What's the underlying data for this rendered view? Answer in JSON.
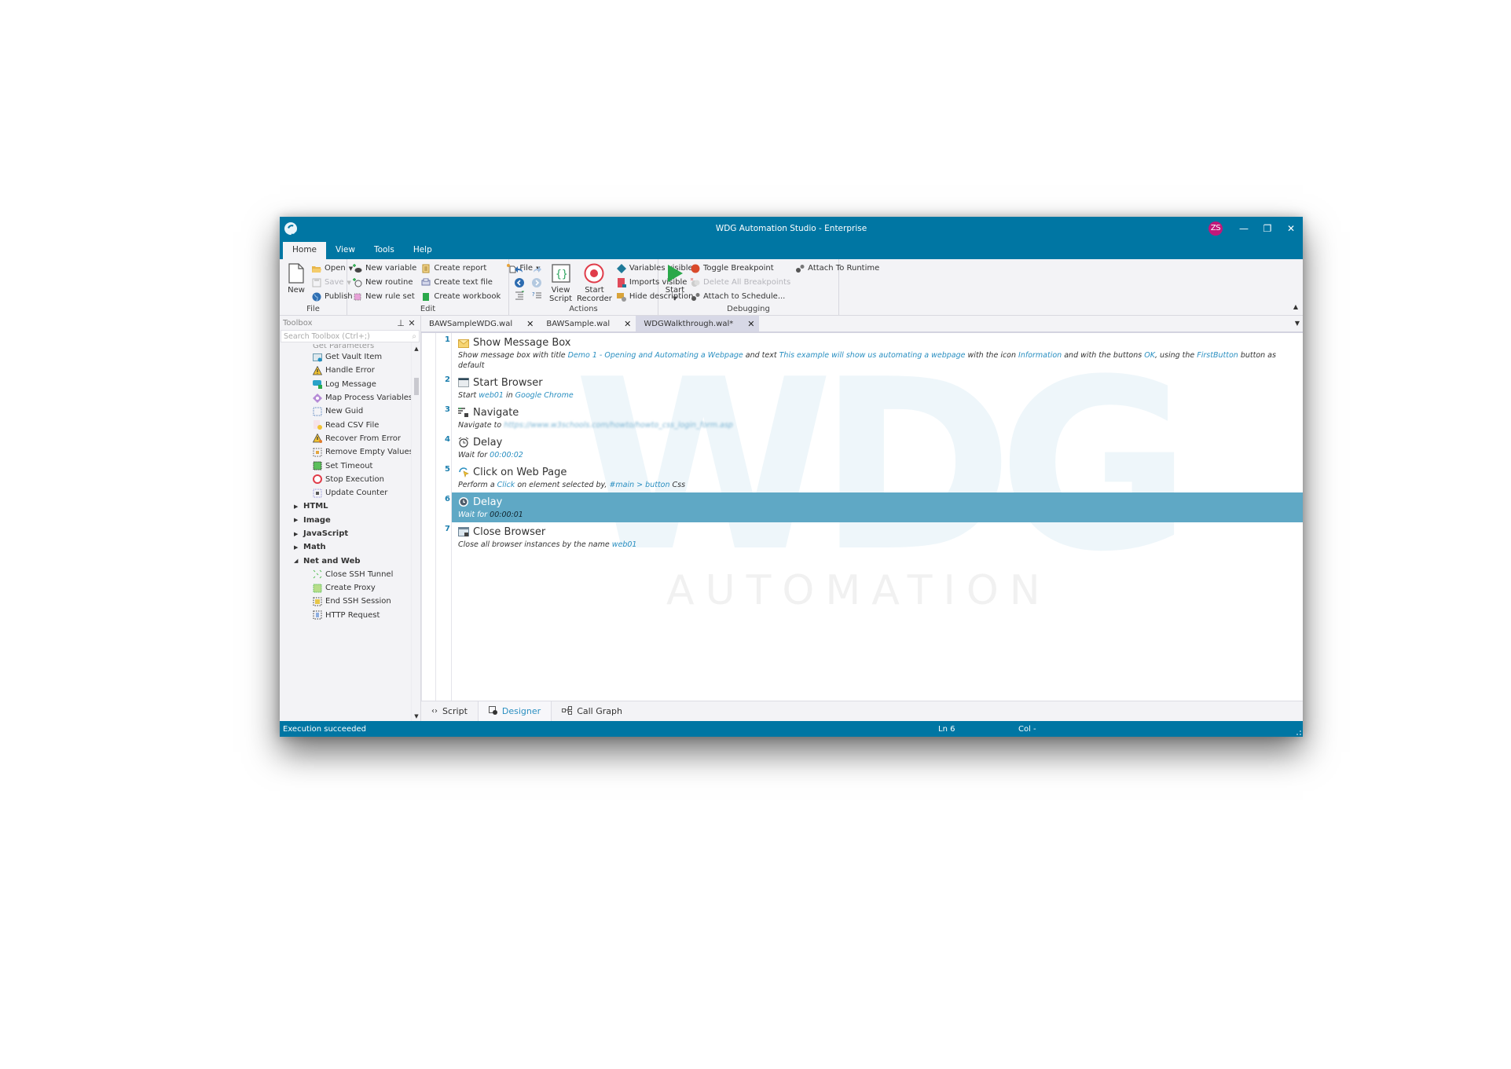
{
  "window": {
    "title": "WDG Automation Studio - Enterprise",
    "user_initials": "ZS",
    "controls": {
      "minimize": "—",
      "restore": "❐",
      "close": "✕"
    }
  },
  "menu": {
    "tabs": [
      {
        "label": "Home",
        "active": true
      },
      {
        "label": "View",
        "active": false
      },
      {
        "label": "Tools",
        "active": false
      },
      {
        "label": "Help",
        "active": false
      }
    ]
  },
  "ribbon": {
    "file_group": {
      "label": "File",
      "new": "New",
      "open": "Open",
      "save": "Save",
      "publish": "Publish"
    },
    "edit_group": {
      "label": "Edit",
      "new_variable": "New variable",
      "new_routine": "New routine",
      "new_rule_set": "New rule set",
      "create_report": "Create report",
      "create_text_file": "Create text file",
      "create_workbook": "Create workbook",
      "file": "File"
    },
    "actions_group": {
      "label": "Actions",
      "view_script_line1": "View",
      "view_script_line2": "Script",
      "start_recorder_line1": "Start",
      "start_recorder_line2": "Recorder",
      "variables_visible": "Variables visible",
      "imports_visible": "Imports visible",
      "hide_description": "Hide description"
    },
    "debugging_group": {
      "label": "Debugging",
      "start": "Start",
      "toggle_breakpoint": "Toggle Breakpoint",
      "delete_all_breakpoints": "Delete All Breakpoints",
      "attach_to_schedule": "Attach to Schedule...",
      "attach_to_runtime": "Attach To Runtime"
    },
    "accent_colors": {
      "record_red": "#e03c4a",
      "start_green": "#2aa84a",
      "braces_green": "#27a25a"
    }
  },
  "toolbox": {
    "title": "Toolbox",
    "search_placeholder": "Search Toolbox (Ctrl+;)",
    "partial_item": "Get Parameters",
    "items": [
      {
        "type": "leaf",
        "label": "Get Vault Item",
        "icon": "vault-icon"
      },
      {
        "type": "leaf",
        "label": "Handle Error",
        "icon": "warning-icon"
      },
      {
        "type": "leaf",
        "label": "Log Message",
        "icon": "log-message-icon"
      },
      {
        "type": "leaf",
        "label": "Map Process Variables",
        "icon": "map-variables-icon"
      },
      {
        "type": "leaf",
        "label": "New Guid",
        "icon": "guid-icon"
      },
      {
        "type": "leaf",
        "label": "Read CSV File",
        "icon": "csv-file-icon"
      },
      {
        "type": "leaf",
        "label": "Recover From Error",
        "icon": "warning-recover-icon"
      },
      {
        "type": "leaf",
        "label": "Remove Empty Values",
        "icon": "remove-empty-icon"
      },
      {
        "type": "leaf",
        "label": "Set Timeout",
        "icon": "timeout-icon"
      },
      {
        "type": "leaf",
        "label": "Stop Execution",
        "icon": "stop-icon"
      },
      {
        "type": "leaf",
        "label": "Update Counter",
        "icon": "counter-icon"
      },
      {
        "type": "cat",
        "label": "HTML",
        "expanded": false
      },
      {
        "type": "cat",
        "label": "Image",
        "expanded": false
      },
      {
        "type": "cat",
        "label": "JavaScript",
        "expanded": false
      },
      {
        "type": "cat",
        "label": "Math",
        "expanded": false
      },
      {
        "type": "cat",
        "label": "Net and Web",
        "expanded": true
      },
      {
        "type": "leaf",
        "label": "Close SSH Tunnel",
        "icon": "ssh-tunnel-icon"
      },
      {
        "type": "leaf",
        "label": "Create Proxy",
        "icon": "proxy-icon"
      },
      {
        "type": "leaf",
        "label": "End SSH Session",
        "icon": "ssh-session-icon"
      },
      {
        "type": "leaf",
        "label": "HTTP Request",
        "icon": "http-request-icon"
      }
    ]
  },
  "editor": {
    "tabs": [
      {
        "label": "BAWSampleWDG.wal",
        "active": false
      },
      {
        "label": "BAWSample.wal",
        "active": false
      },
      {
        "label": "WDGWalkthrough.wal*",
        "active": true
      }
    ],
    "watermark": {
      "big": "WDG",
      "small": "AUTOMATION"
    },
    "steps": [
      {
        "num": "1",
        "title": "Show Message Box",
        "icon": "message-box-icon",
        "desc": [
          {
            "t": "Show message box with title "
          },
          {
            "t": "Demo 1 - Opening and Automating a Webpage",
            "v": true
          },
          {
            "t": " and text "
          },
          {
            "t": "This example will show us automating a webpage",
            "v": true
          },
          {
            "t": " with the icon "
          },
          {
            "t": "Information",
            "v": true
          },
          {
            "t": " and with the buttons "
          },
          {
            "t": "OK",
            "v": true
          },
          {
            "t": ", using the "
          },
          {
            "t": "FirstButton",
            "v": true
          },
          {
            "t": " button as default"
          }
        ]
      },
      {
        "num": "2",
        "title": "Start Browser",
        "icon": "browser-window-icon",
        "desc": [
          {
            "t": "Start "
          },
          {
            "t": "web01",
            "v": true
          },
          {
            "t": " in "
          },
          {
            "t": "Google Chrome",
            "v": true
          }
        ]
      },
      {
        "num": "3",
        "title": "Navigate",
        "icon": "navigate-icon",
        "desc": [
          {
            "t": "Navigate to "
          },
          {
            "t": "https://www.w3schools.com/howto/howto_css_login_form.asp",
            "v": true,
            "blurred": true
          }
        ]
      },
      {
        "num": "4",
        "title": "Delay",
        "icon": "alarm-clock-icon",
        "desc": [
          {
            "t": "Wait for "
          },
          {
            "t": "00:00:02",
            "v": true
          }
        ]
      },
      {
        "num": "5",
        "title": "Click on Web Page",
        "icon": "click-cursor-icon",
        "desc": [
          {
            "t": "Perform a "
          },
          {
            "t": "Click",
            "v": true
          },
          {
            "t": " on element selected by, "
          },
          {
            "t": "#main > button",
            "v": true
          },
          {
            "t": " Css"
          }
        ]
      },
      {
        "num": "6",
        "title": "Delay",
        "icon": "clock-icon",
        "selected": true,
        "desc": [
          {
            "t": "Wait for "
          },
          {
            "t": "00:00:01",
            "v": true
          }
        ]
      },
      {
        "num": "7",
        "title": "Close Browser",
        "icon": "close-browser-icon",
        "desc": [
          {
            "t": "Close all browser instances by the name "
          },
          {
            "t": "web01",
            "v": true
          }
        ]
      }
    ],
    "bottom_tabs": [
      {
        "label": "Script",
        "icon": "code-icon",
        "active": false
      },
      {
        "label": "Designer",
        "icon": "designer-icon",
        "active": true
      },
      {
        "label": "Call Graph",
        "icon": "call-graph-icon",
        "active": false
      }
    ]
  },
  "status": {
    "message": "Execution succeeded",
    "line": "Ln  6",
    "column": "Col  -"
  },
  "colors": {
    "title_bar": "#0076a3",
    "selected_step": "#5fa8c5",
    "value_link": "#2a8fc1",
    "avatar": "#c2187a"
  }
}
